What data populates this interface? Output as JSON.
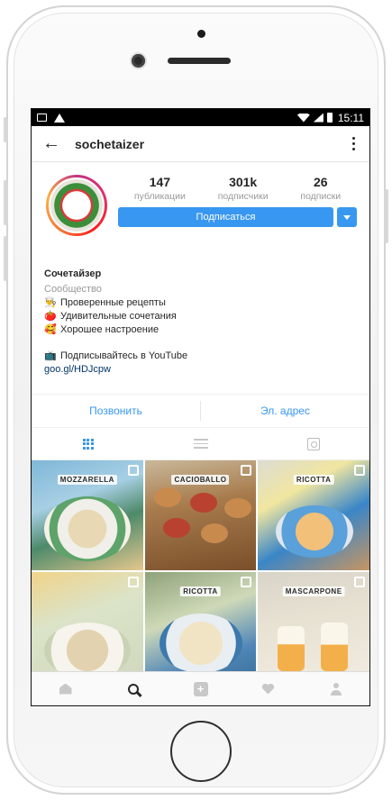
{
  "status_bar": {
    "time": "15:11"
  },
  "header": {
    "username": "sochetaizer"
  },
  "profile": {
    "stats": [
      {
        "value": "147",
        "label": "публикации"
      },
      {
        "value": "301k",
        "label": "подписчики"
      },
      {
        "value": "26",
        "label": "подписки"
      }
    ],
    "follow_label": "Подписаться",
    "name": "Сочетайзер",
    "category": "Сообщество",
    "bio_lines": [
      {
        "emoji": "👨‍🍳",
        "text": "Проверенные рецепты"
      },
      {
        "emoji": "🍅",
        "text": "Удивительные сочетания"
      },
      {
        "emoji": "🥰",
        "text": "Хорошее настроение"
      }
    ],
    "youtube_line": {
      "emoji": "📺",
      "text": "Подписывайтесь в YouTube"
    },
    "link": "goo.gl/HDJcpw"
  },
  "contact": {
    "call_label": "Позвонить",
    "email_label": "Эл. адрес"
  },
  "photos": [
    {
      "label": "MOZZARELLA"
    },
    {
      "label": "CAСIОВАLLО"
    },
    {
      "label": "RICOTTA"
    },
    {
      "label": ""
    },
    {
      "label": "RICOTTA"
    },
    {
      "label": "MASCARPONE"
    }
  ],
  "colors": {
    "accent": "#3897f0",
    "text": "#262626",
    "muted": "#999999"
  }
}
